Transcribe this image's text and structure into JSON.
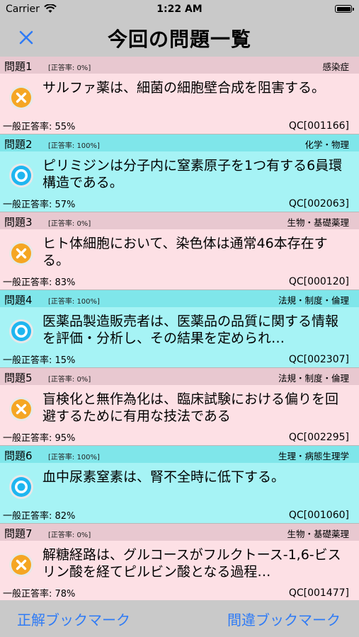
{
  "status": {
    "carrier": "Carrier",
    "time": "1:22 AM"
  },
  "nav": {
    "title": "今回の問題一覧"
  },
  "questions": [
    {
      "num": "問題1",
      "rate": "[正答率: 0%]",
      "category": "感染症",
      "text": "サルファ薬は、細菌の細胞壁合成を阻害する。",
      "general": "一般正答率: 55%",
      "qc": "QC[001166]",
      "result": "wrong"
    },
    {
      "num": "問題2",
      "rate": "[正答率: 100%]",
      "category": "化学・物理",
      "text": "ピリミジンは分子内に窒素原子を1つ有する6員環構造である。",
      "general": "一般正答率: 57%",
      "qc": "QC[002063]",
      "result": "right"
    },
    {
      "num": "問題3",
      "rate": "[正答率: 0%]",
      "category": "生物・基礎薬理",
      "text": "ヒト体細胞において、染色体は通常46本存在する。",
      "general": "一般正答率: 83%",
      "qc": "QC[000120]",
      "result": "wrong"
    },
    {
      "num": "問題4",
      "rate": "[正答率: 100%]",
      "category": "法規・制度・倫理",
      "text": "医薬品製造販売者は、医薬品の品質に関する情報を評価・分析し、その結果を定められ…",
      "general": "一般正答率: 15%",
      "qc": "QC[002307]",
      "result": "right"
    },
    {
      "num": "問題5",
      "rate": "[正答率: 0%]",
      "category": "法規・制度・倫理",
      "text": "盲検化と無作為化は、臨床試験における偏りを回避するために有用な技法である",
      "general": "一般正答率: 95%",
      "qc": "QC[002295]",
      "result": "wrong"
    },
    {
      "num": "問題6",
      "rate": "[正答率: 100%]",
      "category": "生理・病態生理学",
      "text": "血中尿素窒素は、腎不全時に低下する。",
      "general": "一般正答率: 82%",
      "qc": "QC[001060]",
      "result": "right"
    },
    {
      "num": "問題7",
      "rate": "[正答率: 0%]",
      "category": "生物・基礎薬理",
      "text": "解糖経路は、グルコースがフルクトース-1,6-ビスリン酸を経てピルビン酸となる過程…",
      "general": "一般正答率: 78%",
      "qc": "QC[001477]",
      "result": "wrong"
    }
  ],
  "toolbar": {
    "left_label": "正解ブックマーク",
    "right_label": "間違ブックマーク"
  },
  "colors": {
    "accent": "#2f7bf5",
    "wrong_bg": "#fde0e5",
    "right_bg": "#a6f3f5",
    "wrong_icon": "#f5a623",
    "right_icon": "#1fb6f0"
  },
  "icons": {
    "wrong": "cross-circle-icon",
    "right": "ring-circle-icon",
    "close": "close-icon",
    "wifi": "wifi-icon",
    "battery": "battery-icon"
  }
}
